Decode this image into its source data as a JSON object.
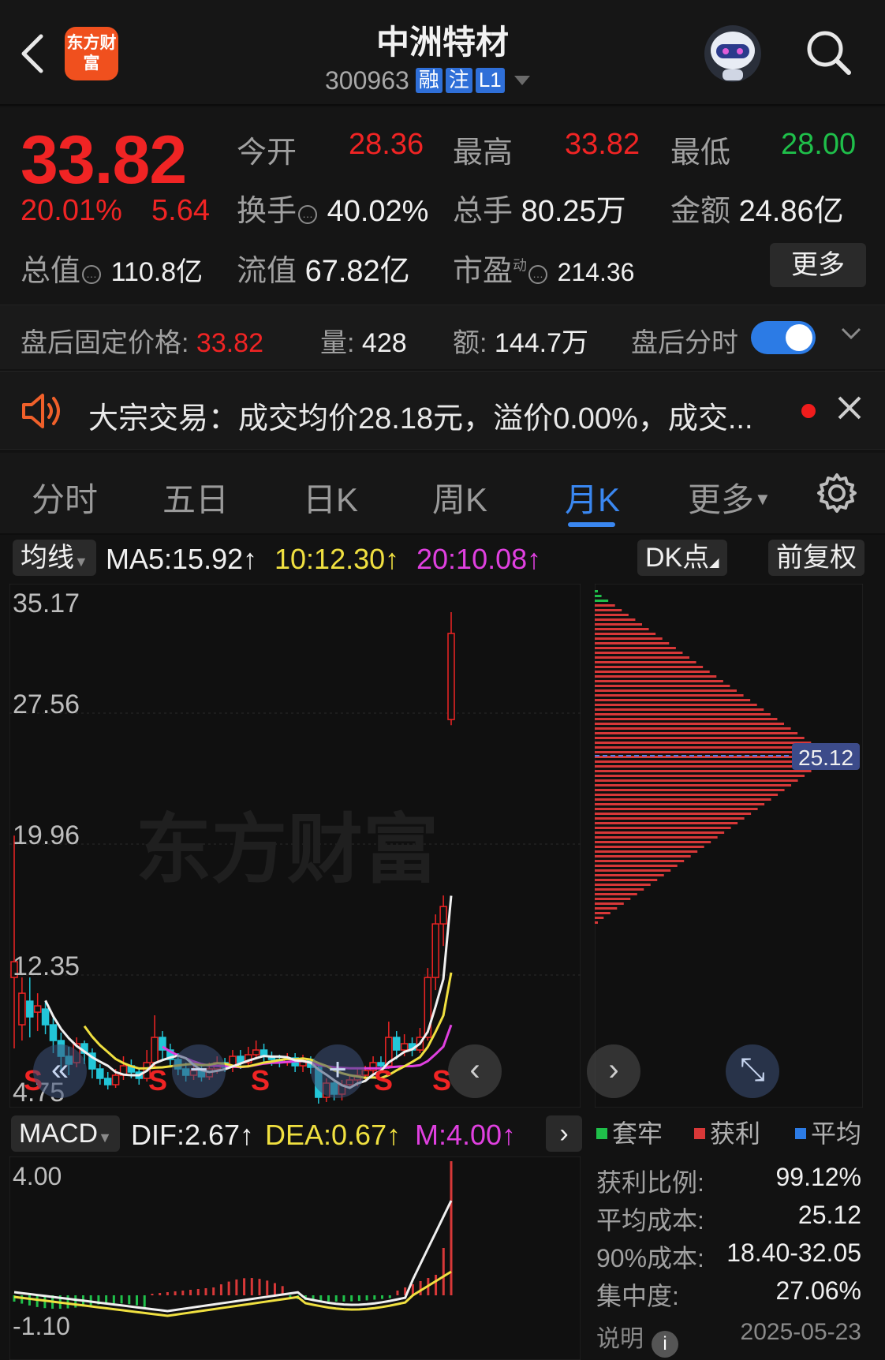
{
  "header": {
    "logo_text": "东方财富",
    "title": "中洲特材",
    "code": "300963",
    "tags": [
      "融",
      "注",
      "L1"
    ]
  },
  "quote": {
    "price": "33.82",
    "change_pct": "20.01%",
    "change_amt": "5.64",
    "open_label": "今开",
    "open_value": "28.36",
    "high_label": "最高",
    "high_value": "33.82",
    "low_label": "最低",
    "low_value": "28.00",
    "turnover_label": "换手",
    "turnover_value": "40.02%",
    "volume_label": "总手",
    "volume_value": "80.25万",
    "amount_label": "金额",
    "amount_value": "24.86亿",
    "mktcap_label": "总值",
    "mktcap_value": "110.8亿",
    "float_label": "流值",
    "float_value": "67.82亿",
    "pe_label": "市盈",
    "pe_sup": "动",
    "pe_value": "214.36",
    "more_label": "更多"
  },
  "after_hours": {
    "price_label": "盘后固定价格:",
    "price_value": "33.82",
    "vol_label": "量:",
    "vol_value": "428",
    "amt_label": "额:",
    "amt_value": "144.7万",
    "toggle_label": "盘后分时",
    "toggle_on": true
  },
  "bulk_trade": {
    "text": "大宗交易：成交均价28.18元，溢价0.00%，成交..."
  },
  "tabs": {
    "items": [
      "分时",
      "五日",
      "日K",
      "周K",
      "月K",
      "更多"
    ],
    "active": "月K"
  },
  "indicator": {
    "selector": "均线",
    "ma5": "MA5:15.92↑",
    "ma10": "10:12.30↑",
    "ma20": "20:10.08↑",
    "dk_label": "DK点",
    "adjust_label": "前复权",
    "ma5_color": "#f0f0f0",
    "ma10_color": "#f0e040",
    "ma20_color": "#e040e0"
  },
  "main_chart": {
    "y_labels": [
      "35.17",
      "27.56",
      "19.96",
      "12.35",
      "4.75"
    ],
    "signal_label": "S",
    "watermark": "东方财富",
    "up_color": "#f02424",
    "down_color": "#22c6d8"
  },
  "chip_chart": {
    "avg_cost_label": "25.12",
    "profit_color": "#d83838",
    "trapped_color": "#1fbf4a"
  },
  "macd": {
    "selector": "MACD",
    "dif": "DIF:2.67↑",
    "dea": "DEA:0.67↑",
    "m": "M:4.00↑",
    "y_top": "4.00",
    "y_bottom": "-1.10"
  },
  "chip_info": {
    "legend": [
      "套牢",
      "获利",
      "平均"
    ],
    "legend_colors": [
      "#1fbf4a",
      "#d83838",
      "#2c7be5"
    ],
    "rows": [
      {
        "k": "获利比例:",
        "v": "99.12%"
      },
      {
        "k": "平均成本:",
        "v": "25.12"
      },
      {
        "k": "90%成本:",
        "v": "18.40-32.05"
      },
      {
        "k": "集中度:",
        "v": "27.06%"
      }
    ],
    "note_label": "说明",
    "date": "2025-05-23"
  }
}
